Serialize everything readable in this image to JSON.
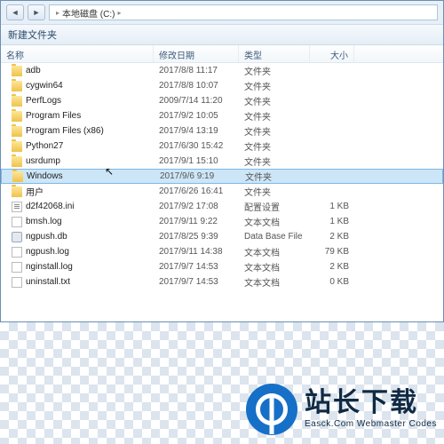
{
  "breadcrumb": {
    "drive": "本地磁盘 (C:)",
    "sep": "▸"
  },
  "toolbar": {
    "label": "新建文件夹"
  },
  "columns": {
    "name": "名称",
    "date": "修改日期",
    "type": "类型",
    "size": "大小"
  },
  "selected_index": 7,
  "rows": [
    {
      "icon": "fld",
      "name": "adb",
      "date": "2017/8/8 11:17",
      "type": "文件夹",
      "size": ""
    },
    {
      "icon": "fld",
      "name": "cygwin64",
      "date": "2017/8/8 10:07",
      "type": "文件夹",
      "size": ""
    },
    {
      "icon": "fld",
      "name": "PerfLogs",
      "date": "2009/7/14 11:20",
      "type": "文件夹",
      "size": ""
    },
    {
      "icon": "fld",
      "name": "Program Files",
      "date": "2017/9/2 10:05",
      "type": "文件夹",
      "size": ""
    },
    {
      "icon": "fld",
      "name": "Program Files (x86)",
      "date": "2017/9/4 13:19",
      "type": "文件夹",
      "size": ""
    },
    {
      "icon": "fld",
      "name": "Python27",
      "date": "2017/6/30 15:42",
      "type": "文件夹",
      "size": ""
    },
    {
      "icon": "fld",
      "name": "usrdump",
      "date": "2017/9/1 15:10",
      "type": "文件夹",
      "size": ""
    },
    {
      "icon": "fld",
      "name": "Windows",
      "date": "2017/9/6 9:19",
      "type": "文件夹",
      "size": ""
    },
    {
      "icon": "fld",
      "name": "用户",
      "date": "2017/6/26 16:41",
      "type": "文件夹",
      "size": ""
    },
    {
      "icon": "ini",
      "name": "d2f42068.ini",
      "date": "2017/9/2 17:08",
      "type": "配置设置",
      "size": "1 KB"
    },
    {
      "icon": "log",
      "name": "bmsh.log",
      "date": "2017/9/11 9:22",
      "type": "文本文档",
      "size": "1 KB"
    },
    {
      "icon": "db",
      "name": "ngpush.db",
      "date": "2017/8/25 9:39",
      "type": "Data Base File",
      "size": "2 KB"
    },
    {
      "icon": "log",
      "name": "ngpush.log",
      "date": "2017/9/11 14:38",
      "type": "文本文档",
      "size": "79 KB"
    },
    {
      "icon": "log",
      "name": "nginstall.log",
      "date": "2017/9/7 14:53",
      "type": "文本文档",
      "size": "2 KB"
    },
    {
      "icon": "txt",
      "name": "uninstall.txt",
      "date": "2017/9/7 14:53",
      "type": "文本文档",
      "size": "0 KB"
    }
  ],
  "brand": {
    "cn": "站长下载",
    "en": "Easck.Com Webmaster Codes"
  }
}
